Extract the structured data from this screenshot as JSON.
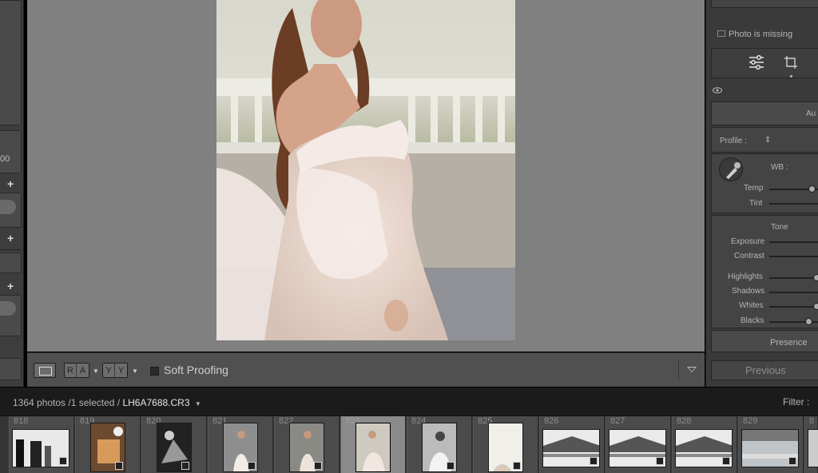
{
  "left_panel": {
    "partial_value": "00",
    "plus_1": "+",
    "plus_2": "+",
    "plus_3": "+"
  },
  "toolbar": {
    "view_mode": "loupe",
    "compare_left": "R",
    "compare_right": "A",
    "survey_left": "Y",
    "survey_right": "Y",
    "soft_proofing_label": "Soft Proofing",
    "soft_proofing_checked": false
  },
  "right_panel": {
    "photo_missing": "Photo is missing",
    "auto_label": "Au",
    "profile_label": "Profile :",
    "wb_label": "WB :",
    "temp_label": "Temp",
    "tint_label": "Tint",
    "tone_label": "Tone",
    "exposure_label": "Exposure",
    "contrast_label": "Contrast",
    "highlights_label": "Highlights",
    "shadows_label": "Shadows",
    "whites_label": "Whites",
    "blacks_label": "Blacks",
    "presence_label": "Presence",
    "previous_button": "Previous"
  },
  "filmstrip_bar": {
    "photos_count": "1364 photos",
    "selected": "/1 selected /",
    "filename": "LH6A7688.CR3",
    "filter_label": "Filter :"
  },
  "filmstrip": {
    "cells": [
      {
        "num": "818",
        "orientation": "landscape"
      },
      {
        "num": "819",
        "orientation": "portrait"
      },
      {
        "num": "820",
        "orientation": "portrait"
      },
      {
        "num": "821",
        "orientation": "portrait"
      },
      {
        "num": "822",
        "orientation": "portrait"
      },
      {
        "num": "823",
        "orientation": "portrait",
        "selected": true
      },
      {
        "num": "824",
        "orientation": "portrait"
      },
      {
        "num": "825",
        "orientation": "portrait"
      },
      {
        "num": "826",
        "orientation": "landscape"
      },
      {
        "num": "827",
        "orientation": "landscape"
      },
      {
        "num": "828",
        "orientation": "landscape"
      },
      {
        "num": "829",
        "orientation": "landscape"
      },
      {
        "num": "8",
        "orientation": "landscape"
      }
    ]
  }
}
